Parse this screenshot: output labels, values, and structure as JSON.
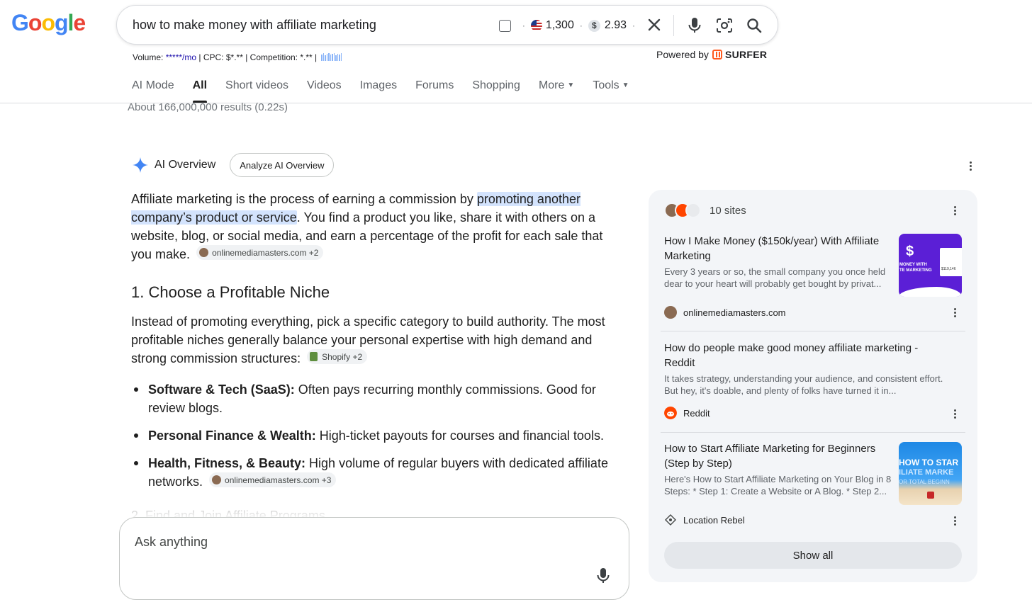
{
  "header": {
    "logo": "Google",
    "search": {
      "query": "how to make money with affiliate marketing",
      "search_volume": "1,300",
      "cpc": "2.93"
    },
    "metrics": {
      "volume_label": "Volume: ",
      "volume_value": "*****/mo",
      "rest": " | CPC: $*.** | Competition: *.** | "
    },
    "powered_by": "Powered by",
    "surfer": "SURFER"
  },
  "tabs": [
    {
      "label": "AI Mode"
    },
    {
      "label": "All",
      "active": true
    },
    {
      "label": "Short videos"
    },
    {
      "label": "Videos"
    },
    {
      "label": "Images"
    },
    {
      "label": "Forums"
    },
    {
      "label": "Shopping"
    },
    {
      "label": "More"
    },
    {
      "label": "Tools"
    }
  ],
  "results_stats": "About 166,000,000 results (0.22s)",
  "ai_overview": {
    "title": "AI Overview",
    "analyze_button": "Analyze AI Overview",
    "intro_before": "Affiliate marketing is the process of earning a commission by ",
    "intro_highlight": "promoting another company’s product or service",
    "intro_after": ". You find a product you like, share it with others on a website, blog, or social media, and earn a percentage of the profit for each sale that you make.",
    "intro_chip": "onlinemediamasters.com +2",
    "section1_heading": "1. Choose a Profitable Niche",
    "section1_text": "Instead of promoting everything, pick a specific category to build authority. The most profitable niches generally balance your personal expertise with high demand and strong commission structures:",
    "section1_chip": "Shopify +2",
    "bullets": [
      {
        "bold": "Software & Tech (SaaS):",
        "text": " Often pays recurring monthly commissions. Good for review blogs."
      },
      {
        "bold": "Personal Finance & Wealth:",
        "text": " High-ticket payouts for courses and financial tools."
      },
      {
        "bold": "Health, Fitness, & Beauty:",
        "text": " High volume of regular buyers with dedicated affiliate networks.",
        "chip": "onlinemediamasters.com +3"
      }
    ],
    "faded_next": "2. Find and Join Affiliate Programs"
  },
  "sources": {
    "count_label": "10 sites",
    "cards": [
      {
        "title": "How I Make Money ($150k/year) With Affiliate Marketing",
        "snippet": "Every 3 years or so, the small company you once held dear to your heart will probably get bought by privat...",
        "source": "onlinemediamasters.com",
        "thumb_text": "MONEY WITH\nTE MARKETING",
        "thumb_amount": "$119,146"
      },
      {
        "title": "How do people make good money affiliate marketing - Reddit",
        "snippet": "It takes strategy, understanding your audience, and consistent effort. But hey, it's doable, and plenty of folks have turned it in...",
        "source": "Reddit"
      },
      {
        "title": "How to Start Affiliate Marketing for Beginners (Step by Step)",
        "snippet": "Here's How to Start Affiliate Marketing on Your Blog in 8 Steps: * Step 1: Create a Website or A Blog. * Step 2...",
        "source": "Location Rebel",
        "thumb_line1": "HOW TO STAR",
        "thumb_line2": "ILIATE MARKE",
        "thumb_line3": "OR TOTAL BEGINN"
      }
    ],
    "show_all": "Show all"
  },
  "ask": {
    "placeholder": "Ask anything"
  },
  "colors": {
    "google_blue": "#4285F4",
    "google_red": "#EA4335",
    "google_yellow": "#FBBC05",
    "google_green": "#34A853",
    "highlight": "#d3e3fd",
    "panel_bg": "#f3f5f8",
    "surfer_orange": "#ff5a1f"
  },
  "icons": [
    "checkbox-icon",
    "us-flag-icon",
    "dollar-icon",
    "close-icon",
    "mic-icon",
    "camera-lens-icon",
    "search-icon",
    "sparkle-icon",
    "more-vert-icon",
    "reddit-icon",
    "location-rebel-icon"
  ]
}
